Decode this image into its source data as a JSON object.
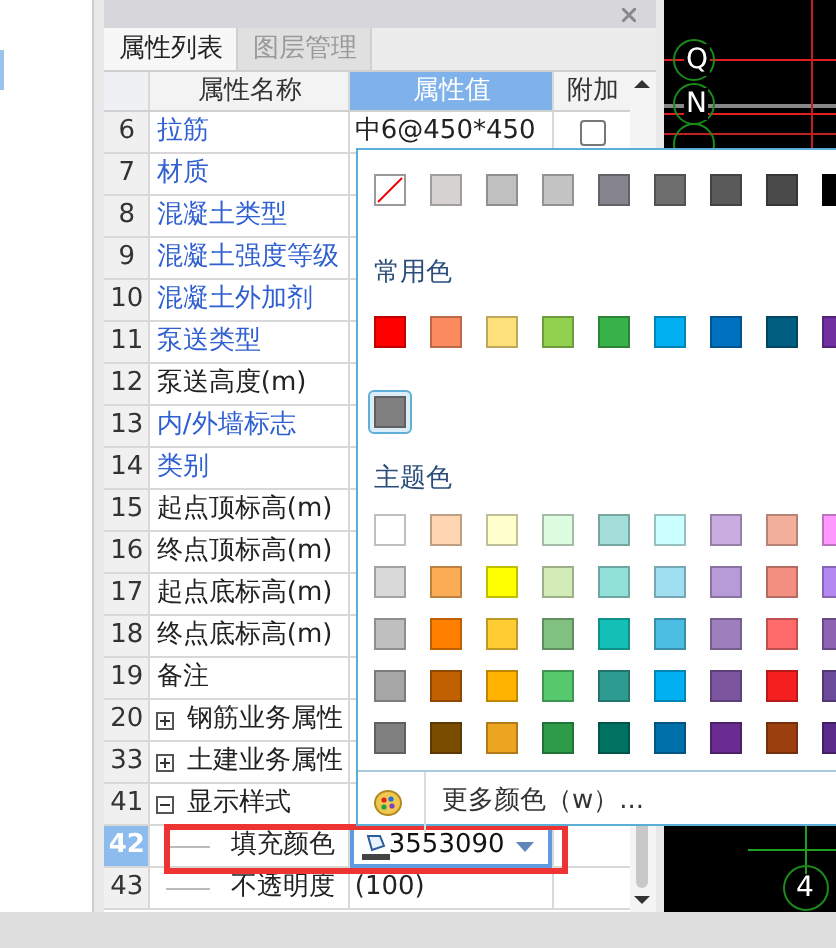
{
  "panel": {
    "tabs": [
      {
        "label": "属性列表",
        "selected": true
      },
      {
        "label": "图层管理",
        "selected": false
      }
    ],
    "columns": [
      "属性名称",
      "属性值",
      "附加"
    ],
    "rows": [
      {
        "num": "6",
        "name": "拉筋",
        "link": true,
        "selected": false,
        "value": "中6@450*450",
        "extra_checked": false
      },
      {
        "num": "7",
        "name": "材质",
        "link": true,
        "selected": false
      },
      {
        "num": "8",
        "name": "混凝土类型",
        "link": true,
        "selected": false
      },
      {
        "num": "9",
        "name": "混凝土强度等级",
        "link": true,
        "selected": false
      },
      {
        "num": "10",
        "name": "混凝土外加剂",
        "link": true,
        "selected": false
      },
      {
        "num": "11",
        "name": "泵送类型",
        "link": true,
        "selected": false
      },
      {
        "num": "12",
        "name": "泵送高度(m)",
        "link": false,
        "selected": false
      },
      {
        "num": "13",
        "name": "内/外墙标志",
        "link": true,
        "selected": false
      },
      {
        "num": "14",
        "name": "类别",
        "link": true,
        "selected": false
      },
      {
        "num": "15",
        "name": "起点顶标高(m)",
        "link": false,
        "selected": false
      },
      {
        "num": "16",
        "name": "终点顶标高(m)",
        "link": false,
        "selected": false
      },
      {
        "num": "17",
        "name": "起点底标高(m)",
        "link": false,
        "selected": false
      },
      {
        "num": "18",
        "name": "终点底标高(m)",
        "link": false,
        "selected": false
      },
      {
        "num": "19",
        "name": "备注",
        "link": false,
        "selected": false
      },
      {
        "num": "20",
        "name": "钢筋业务属性",
        "link": false,
        "selected": false,
        "expanded": false
      },
      {
        "num": "33",
        "name": "土建业务属性",
        "link": false,
        "selected": false,
        "expanded": false
      },
      {
        "num": "41",
        "name": "显示样式",
        "link": false,
        "selected": false,
        "expanded": true,
        "children": [
          {
            "num": "42",
            "name": "填充颜色",
            "link": false,
            "selected": true,
            "value": "3553090",
            "kind": "color"
          },
          {
            "num": "43",
            "name": "不透明度",
            "link": false,
            "selected": false,
            "value": "(100)"
          }
        ]
      }
    ]
  },
  "color_popup": {
    "top_row": [
      {
        "kind": "none"
      },
      {
        "color": "#d6d2d2"
      },
      {
        "color": "#c0c0c0"
      },
      {
        "color": "#c4c4c4"
      },
      {
        "color": "#85838c"
      },
      {
        "color": "#6e6e6e"
      },
      {
        "color": "#5a5a5a"
      },
      {
        "color": "#4a4a4a"
      },
      {
        "color": "#000000"
      }
    ],
    "common_label": "常用色",
    "common": [
      {
        "color": "#ff0000"
      },
      {
        "color": "#fb8a5e"
      },
      {
        "color": "#fee07a"
      },
      {
        "color": "#92d050"
      },
      {
        "color": "#38b249"
      },
      {
        "color": "#00b0f0"
      },
      {
        "color": "#0070c0"
      },
      {
        "color": "#005e80"
      },
      {
        "color": "#7030a0"
      }
    ],
    "recent": [
      {
        "color": "#808080",
        "selected": true
      }
    ],
    "theme_label": "主题色",
    "theme": [
      [
        {
          "color": "#ffffff"
        },
        {
          "color": "#fed5b0"
        },
        {
          "color": "#ffffcc"
        },
        {
          "color": "#ddfde0"
        },
        {
          "color": "#a2ddd7"
        },
        {
          "color": "#ccffff"
        },
        {
          "color": "#c9ace0"
        },
        {
          "color": "#f2b09c"
        },
        {
          "color": "#ff99ff"
        }
      ],
      [
        {
          "color": "#d9d9d9"
        },
        {
          "color": "#fdac56"
        },
        {
          "color": "#ffff00"
        },
        {
          "color": "#d2eab5"
        },
        {
          "color": "#90e0d8"
        },
        {
          "color": "#9fdff0"
        },
        {
          "color": "#b79ad8"
        },
        {
          "color": "#f28f80"
        },
        {
          "color": "#b388f0"
        }
      ],
      [
        {
          "color": "#bfbfbf"
        },
        {
          "color": "#ff8000"
        },
        {
          "color": "#ffcc33"
        },
        {
          "color": "#80c080"
        },
        {
          "color": "#14c0b6"
        },
        {
          "color": "#4cbee3"
        },
        {
          "color": "#9c7fbc"
        },
        {
          "color": "#ff6b6b"
        },
        {
          "color": "#8e63b3"
        }
      ],
      [
        {
          "color": "#a6a6a6"
        },
        {
          "color": "#c06000"
        },
        {
          "color": "#ffb300"
        },
        {
          "color": "#55c96b"
        },
        {
          "color": "#2e9b90"
        },
        {
          "color": "#00b0f0"
        },
        {
          "color": "#7b569f"
        },
        {
          "color": "#f42020"
        },
        {
          "color": "#6a4b9a"
        }
      ],
      [
        {
          "color": "#808080"
        },
        {
          "color": "#7a4c00"
        },
        {
          "color": "#eba520"
        },
        {
          "color": "#2d9b48"
        },
        {
          "color": "#007261"
        },
        {
          "color": "#0070aa"
        },
        {
          "color": "#6a2c90"
        },
        {
          "color": "#9c4010"
        },
        {
          "color": "#5a2a8a"
        }
      ]
    ],
    "more_colors": "更多颜色（w）..."
  },
  "canvas": {
    "axis_labels": [
      "Q",
      "N"
    ],
    "bottom_label": "4"
  }
}
